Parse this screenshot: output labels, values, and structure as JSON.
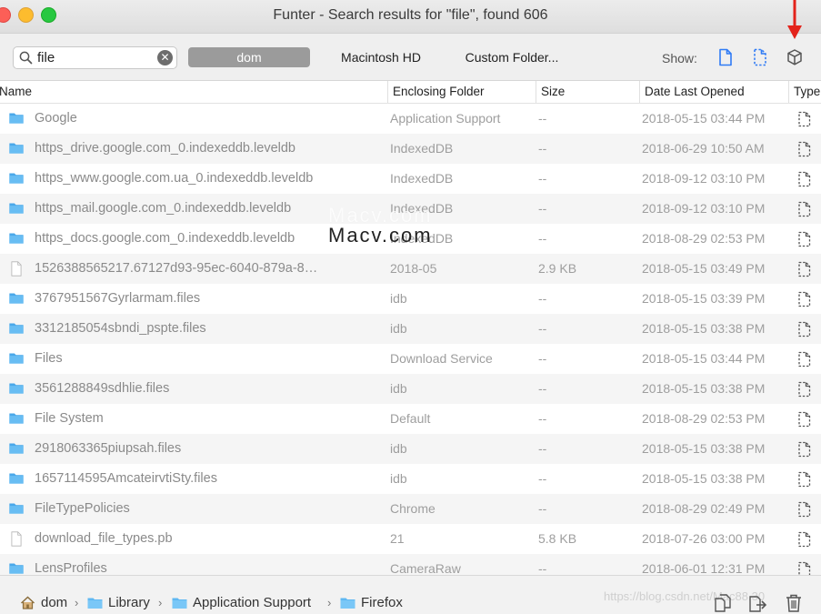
{
  "window": {
    "title": "Funter - Search results for \"file\", found 606"
  },
  "toolbar": {
    "search_value": "file",
    "clear_glyph": "✕",
    "scopes": [
      "dom",
      "Macintosh HD",
      "Custom Folder..."
    ],
    "show_label": "Show:"
  },
  "columns": {
    "name": "Name",
    "folder": "Enclosing Folder",
    "size": "Size",
    "date": "Date Last Opened",
    "type": "Type"
  },
  "rows": [
    {
      "kind": "folder",
      "name": "Google",
      "folder": "Application Support",
      "size": "--",
      "date": "2018-05-15 03:44 PM"
    },
    {
      "kind": "folder",
      "name": "https_drive.google.com_0.indexeddb.leveldb",
      "folder": "IndexedDB",
      "size": "--",
      "date": "2018-06-29 10:50 AM"
    },
    {
      "kind": "folder",
      "name": "https_www.google.com.ua_0.indexeddb.leveldb",
      "folder": "IndexedDB",
      "size": "--",
      "date": "2018-09-12 03:10 PM"
    },
    {
      "kind": "folder",
      "name": "https_mail.google.com_0.indexeddb.leveldb",
      "folder": "IndexedDB",
      "size": "--",
      "date": "2018-09-12 03:10 PM"
    },
    {
      "kind": "folder",
      "name": "https_docs.google.com_0.indexeddb.leveldb",
      "folder": "IndexedDB",
      "size": "--",
      "date": "2018-08-29 02:53 PM"
    },
    {
      "kind": "file",
      "name": "1526388565217.67127d93-95ec-6040-879a-8…",
      "folder": "2018-05",
      "size": "2.9 KB",
      "date": "2018-05-15 03:49 PM"
    },
    {
      "kind": "folder",
      "name": "3767951567Gyrlarmam.files",
      "folder": "idb",
      "size": "--",
      "date": "2018-05-15 03:39 PM"
    },
    {
      "kind": "folder",
      "name": "3312185054sbndi_pspte.files",
      "folder": "idb",
      "size": "--",
      "date": "2018-05-15 03:38 PM"
    },
    {
      "kind": "folder",
      "name": "Files",
      "folder": "Download Service",
      "size": "--",
      "date": "2018-05-15 03:44 PM"
    },
    {
      "kind": "folder",
      "name": "3561288849sdhlie.files",
      "folder": "idb",
      "size": "--",
      "date": "2018-05-15 03:38 PM"
    },
    {
      "kind": "folder",
      "name": "File System",
      "folder": "Default",
      "size": "--",
      "date": "2018-08-29 02:53 PM"
    },
    {
      "kind": "folder",
      "name": "2918063365piupsah.files",
      "folder": "idb",
      "size": "--",
      "date": "2018-05-15 03:38 PM"
    },
    {
      "kind": "folder",
      "name": "1657114595AmcateirvtiSty.files",
      "folder": "idb",
      "size": "--",
      "date": "2018-05-15 03:38 PM"
    },
    {
      "kind": "folder",
      "name": "FileTypePolicies",
      "folder": "Chrome",
      "size": "--",
      "date": "2018-08-29 02:49 PM"
    },
    {
      "kind": "file",
      "name": "download_file_types.pb",
      "folder": "21",
      "size": "5.8 KB",
      "date": "2018-07-26 03:00 PM"
    },
    {
      "kind": "folder",
      "name": "LensProfiles",
      "folder": "CameraRaw",
      "size": "--",
      "date": "2018-06-01 12:31 PM"
    }
  ],
  "path": {
    "items": [
      "dom",
      "Library",
      "Application Support",
      "Firefox"
    ],
    "separator": "›"
  },
  "overlays": {
    "watermark_top": "Macv.com",
    "watermark_bottom": "Macv.com",
    "url": "https://blog.csdn.net/Mac88.30"
  },
  "colors": {
    "folder_blue": "#5fb8f2",
    "active_scope_bg": "#9b9b9b",
    "arrow_red": "#e3231b",
    "row_alt": "#f5f5f5"
  },
  "icons": {
    "search": "search-icon",
    "clear": "clear-icon",
    "show_files": "file-icon",
    "show_hidden": "hidden-file-icon",
    "show_packages": "package-cube-icon",
    "folder": "folder-icon",
    "file": "document-icon",
    "type": "hidden-file-type-icon",
    "home": "home-icon",
    "reveal": "reveal-in-finder-icon",
    "open": "open-icon",
    "trash": "trash-icon",
    "arrow": "red-arrow-icon"
  }
}
